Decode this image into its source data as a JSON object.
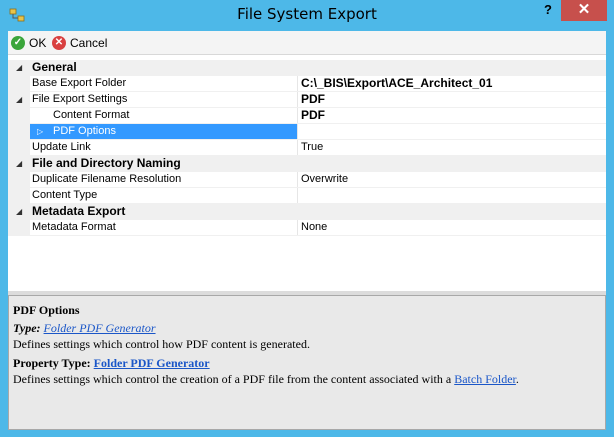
{
  "window": {
    "title": "File System Export",
    "help_label": "?",
    "close_label": "✕"
  },
  "toolbar": {
    "ok_label": "OK",
    "cancel_label": "Cancel"
  },
  "grid": {
    "general_label": "General",
    "base_export_folder_label": "Base Export Folder",
    "base_export_folder_value": "C:\\_BIS\\Export\\ACE_Architect_01",
    "file_export_settings_label": "File Export Settings",
    "file_export_settings_value": "PDF",
    "content_format_label": "Content Format",
    "content_format_value": "PDF",
    "pdf_options_label": "PDF Options",
    "update_link_label": "Update Link",
    "update_link_value": "True",
    "file_dir_naming_label": "File and Directory Naming",
    "dup_filename_label": "Duplicate Filename Resolution",
    "dup_filename_value": "Overwrite",
    "content_type_label": "Content Type",
    "metadata_export_label": "Metadata Export",
    "metadata_format_label": "Metadata Format",
    "metadata_format_value": "None"
  },
  "description": {
    "title": "PDF Options",
    "type_label": "Type:",
    "type_link": "Folder PDF Generator",
    "type_text": "Defines settings which control how PDF content is generated.",
    "property_type_label": "Property Type:",
    "property_type_link": "Folder PDF Generator",
    "property_text_before": "Defines settings which control the creation of a PDF file from the content associated with a",
    "property_text_link": "Batch Folder",
    "property_text_after": "."
  },
  "colors": {
    "accent": "#4db8e8",
    "selection": "#3399ff",
    "close": "#c7504c",
    "link": "#1a56c8"
  },
  "icons": [
    "app-icon",
    "help-icon",
    "close-icon",
    "ok-icon",
    "cancel-icon",
    "expand-icon",
    "collapse-icon"
  ]
}
